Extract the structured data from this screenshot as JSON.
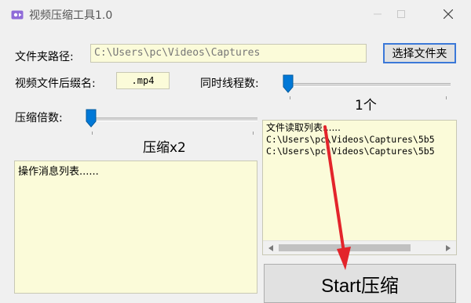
{
  "window": {
    "title": "视频压缩工具1.0",
    "icons": {
      "app": "video-app-icon",
      "minimize": "minimize-icon",
      "maximize": "maximize-icon",
      "close": "close-icon"
    }
  },
  "form": {
    "folder_label": "文件夹路径:",
    "folder_value": "C:\\Users\\pc\\Videos\\Captures",
    "choose_folder_label": "选择文件夹",
    "ext_label": "视频文件后缀名:",
    "ext_value": ".mp4",
    "threads_label": "同时线程数:",
    "threads_value": "1个",
    "threads_slider_level": 0,
    "compress_label": "压缩倍数:",
    "compress_value": "压缩x2",
    "compress_slider_level": 0
  },
  "ops_list": {
    "header": "操作消息列表......"
  },
  "files_list": {
    "header": "文件读取列表......",
    "items": [
      "C:\\Users\\pc\\Videos\\Captures\\5b5",
      "C:\\Users\\pc\\Videos\\Captures\\5b5"
    ]
  },
  "start_button": {
    "label": "Start压缩"
  },
  "colors": {
    "field_bg": "#fbfbd9",
    "accent": "#0078d7",
    "annotation": "#e3242b"
  }
}
